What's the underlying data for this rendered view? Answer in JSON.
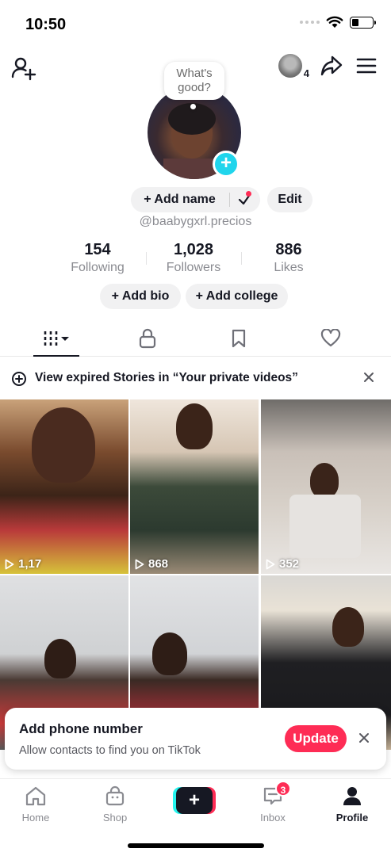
{
  "status_bar": {
    "time": "10:50"
  },
  "header": {
    "avatar_bubble": "What's good?",
    "mini_avatar_count": "4"
  },
  "profile": {
    "add_name_label": "+ Add name",
    "edit_label": "Edit",
    "username": "@baabygxrl.precios",
    "stats": [
      {
        "value": "154",
        "label": "Following"
      },
      {
        "value": "1,028",
        "label": "Followers"
      },
      {
        "value": "886",
        "label": "Likes"
      }
    ],
    "add_bio_label": "+ Add bio",
    "add_college_label": "+ Add college"
  },
  "tabs": [
    "videos-grid",
    "private",
    "saved",
    "liked"
  ],
  "stories_banner": {
    "text": "View expired Stories in “Your private videos”"
  },
  "videos": [
    {
      "views": "1,17"
    },
    {
      "views": "868"
    },
    {
      "views": "352"
    },
    {
      "views": ""
    },
    {
      "views": ""
    },
    {
      "views": ""
    }
  ],
  "phone_prompt": {
    "title": "Add phone number",
    "subtitle": "Allow contacts to find you on TikTok",
    "button": "Update"
  },
  "bottom_nav": {
    "items": [
      {
        "label": "Home"
      },
      {
        "label": "Shop"
      },
      {
        "label": ""
      },
      {
        "label": "Inbox",
        "badge": "3"
      },
      {
        "label": "Profile"
      }
    ]
  },
  "colors": {
    "accent": "#fe2c55",
    "cyan": "#25f4ee",
    "plus_badge": "#20d5ec",
    "text": "#161823",
    "muted": "#8a8b91"
  }
}
